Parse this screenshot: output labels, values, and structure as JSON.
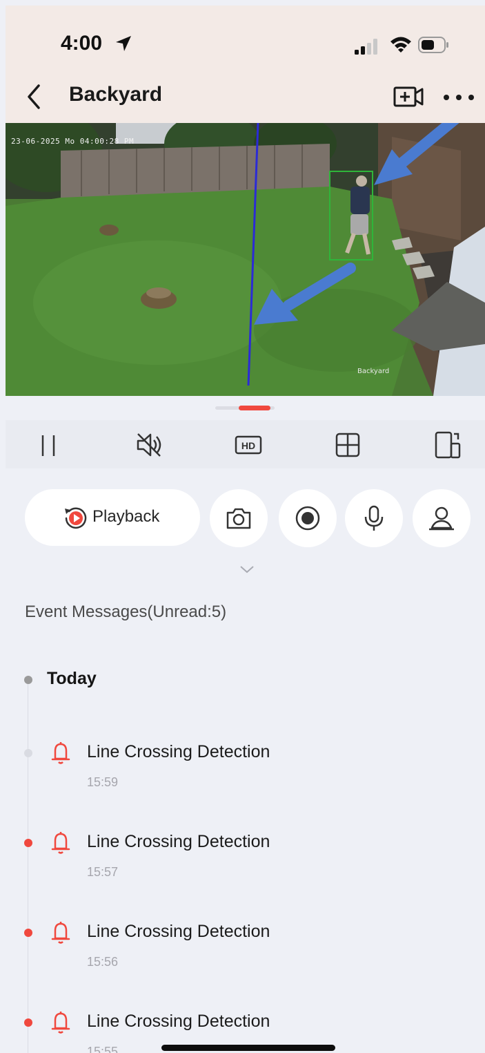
{
  "status_bar": {
    "time": "4:00",
    "icons": [
      "location-arrow-icon",
      "cellular-signal-icon",
      "wifi-icon",
      "battery-icon"
    ]
  },
  "nav": {
    "title": "Backyard",
    "icons": [
      "back-chevron-icon",
      "add-camera-icon",
      "more-dots-icon"
    ]
  },
  "video": {
    "timestamp_overlay": "23-06-2025 Mo 04:00:28 PM",
    "camera_label_overlay": "Backyard",
    "annotations": [
      "detection-box",
      "virtual-line",
      "arrow-to-person",
      "arrow-to-line"
    ],
    "colors": {
      "detection_box": "#2fb53a",
      "virtual_line": "#2b2bd6",
      "arrow": "#4a7bd0"
    }
  },
  "controls": {
    "items": [
      "pause-icon",
      "mute-icon",
      "hd-icon",
      "grid-view-icon",
      "rotate-screen-icon"
    ]
  },
  "actions": {
    "playback_label": "Playback",
    "circle_buttons": [
      "snapshot-camera-icon",
      "record-icon",
      "microphone-icon",
      "ptz-person-icon"
    ]
  },
  "events": {
    "header": "Event Messages(Unread:5)",
    "group_label": "Today",
    "items": [
      {
        "title": "Line Crossing Detection",
        "time": "15:59",
        "unread": false
      },
      {
        "title": "Line Crossing Detection",
        "time": "15:57",
        "unread": true
      },
      {
        "title": "Line Crossing Detection",
        "time": "15:56",
        "unread": true
      },
      {
        "title": "Line Crossing Detection",
        "time": "15:55",
        "unread": true
      }
    ]
  },
  "colors": {
    "accent": "#f0483e",
    "header_bg": "#f3eae6",
    "page_bg": "#eef0f6",
    "read_dot": "#d9dbe2",
    "unread_dot": "#f0483e"
  }
}
